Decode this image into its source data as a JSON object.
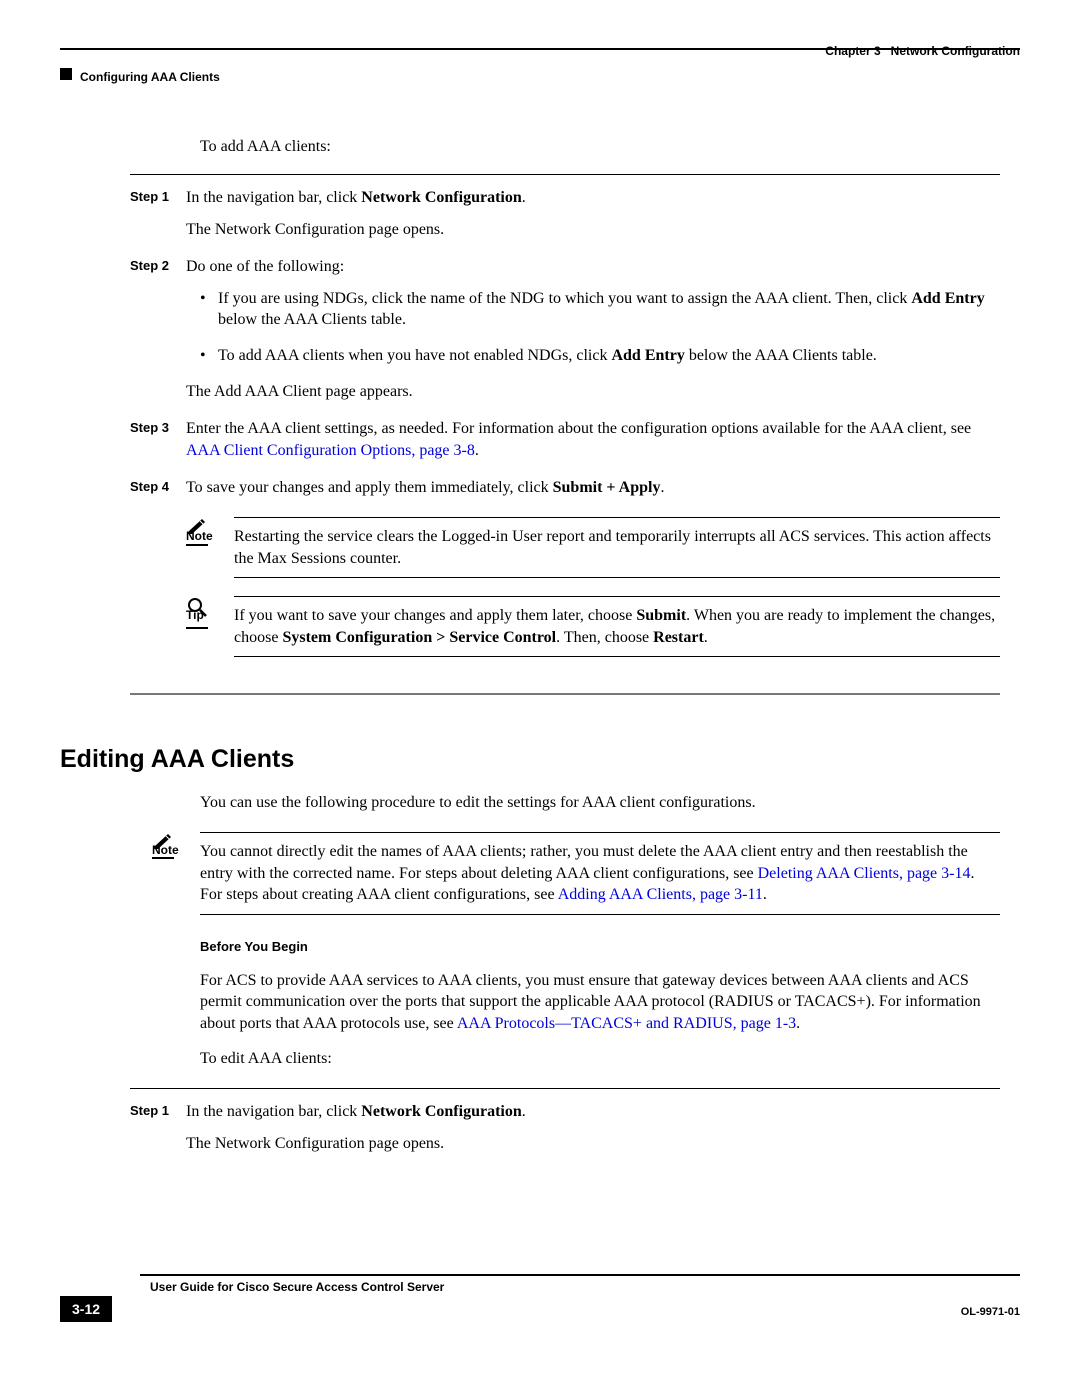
{
  "header": {
    "chapter_label": "Chapter 3",
    "chapter_title": "Network Configuration",
    "section_title": "Configuring AAA Clients"
  },
  "intro": "To add AAA clients:",
  "steps": [
    {
      "label": "Step 1",
      "text_prefix": "In the navigation bar, click ",
      "bold1": "Network Configuration",
      "text_suffix": ".",
      "after": "The Network Configuration page opens."
    },
    {
      "label": "Step 2",
      "text": "Do one of the following:",
      "bullets": [
        {
          "a": "If you are using NDGs, click the name of the NDG to which you want to assign the AAA client. Then, click ",
          "b1": "Add Entry",
          "c": " below the AAA Clients table."
        },
        {
          "a": "To add AAA clients when you have not enabled NDGs, click ",
          "b1": "Add Entry",
          "c": " below the AAA Clients table."
        }
      ],
      "after": "The Add AAA Client page appears."
    },
    {
      "label": "Step 3",
      "text": "Enter the AAA client settings, as needed. For information about the configuration options available for the AAA client, see ",
      "link": "AAA Client Configuration Options, page 3-8",
      "suffix": "."
    },
    {
      "label": "Step 4",
      "text_prefix": "To save your changes and apply them immediately, click ",
      "bold1": "Submit + Apply",
      "text_suffix": "."
    }
  ],
  "note": {
    "label": "Note",
    "text": "Restarting the service clears the Logged-in User report and temporarily interrupts all ACS services. This action affects the Max Sessions counter."
  },
  "tip": {
    "label": "Tip",
    "a": "If you want to save your changes and apply them later, choose ",
    "b1": "Submit",
    "b": ". When you are ready to implement the changes, choose ",
    "b2": "System Configuration > Service Control",
    "c": ". Then, choose ",
    "b3": "Restart",
    "d": "."
  },
  "section2": {
    "heading": "Editing AAA Clients",
    "intro": "You can use the following procedure to edit the settings for AAA client configurations.",
    "note": {
      "label": "Note",
      "a": "You cannot directly edit the names of AAA clients; rather, you must delete the AAA client entry and then reestablish the entry with the corrected name. For steps about deleting AAA client configurations, see ",
      "link1": "Deleting AAA Clients, page 3-14",
      "b": ". For steps about creating AAA client configurations, see ",
      "link2": "Adding AAA Clients, page 3-11",
      "c": "."
    },
    "before_heading": "Before You Begin",
    "before_text_a": "For ACS to provide AAA services to AAA clients, you must ensure that gateway devices between AAA clients and ACS permit communication over the ports that support the applicable AAA protocol (RADIUS or TACACS+). For information about ports that AAA protocols use, see ",
    "before_link": "AAA Protocols—TACACS+ and RADIUS, page 1-3",
    "before_text_b": ".",
    "intro2": "To edit AAA clients:",
    "step1": {
      "label": "Step 1",
      "text_prefix": "In the navigation bar, click ",
      "bold1": "Network Configuration",
      "text_suffix": ".",
      "after": "The Network Configuration page opens."
    }
  },
  "footer": {
    "guide_title": "User Guide for Cisco Secure Access Control Server",
    "page_number": "3-12",
    "doc_id": "OL-9971-01"
  }
}
